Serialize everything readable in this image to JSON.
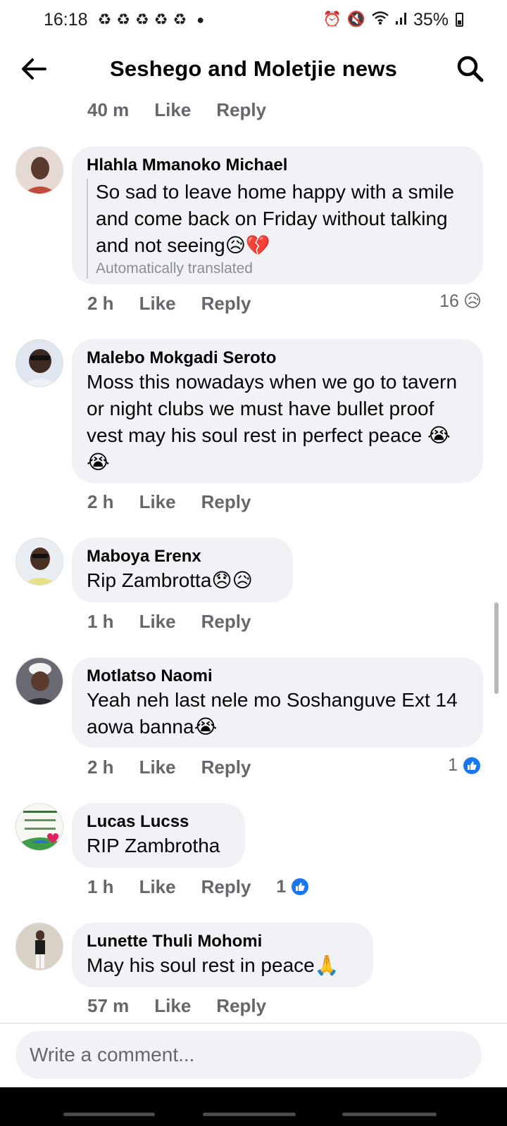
{
  "status_bar": {
    "time": "16:18",
    "battery": "35%",
    "notification_icons": [
      "recycle-icon",
      "recycle-icon",
      "recycle-icon",
      "recycle-icon",
      "recycle-icon"
    ],
    "status_icons": [
      "alarm-icon",
      "mute-icon",
      "wifi-icon",
      "signal-icon",
      "battery-icon"
    ]
  },
  "header": {
    "title": "Seshego and Moletjie news"
  },
  "actions": {
    "like": "Like",
    "reply": "Reply"
  },
  "top_meta": {
    "time": "40 m"
  },
  "comments": [
    {
      "author": "Hlahla Mmanoko Michael",
      "text": "So sad to leave home happy with a smile and come back on Friday without talking and not seeing😥💔",
      "translated_note": "Automatically translated",
      "time": "2 h",
      "reaction_count": "16",
      "reaction_emoji": "😥"
    },
    {
      "author": "Malebo Mokgadi Seroto",
      "text": "Moss this nowadays when we go to tavern or night clubs we must have bullet proof vest may his soul rest in perfect peace 😭😭",
      "time": "2 h"
    },
    {
      "author": "Maboya Erenx",
      "text": "Rip Zambrotta😞😥",
      "time": "1 h"
    },
    {
      "author": "Motlatso Naomi",
      "text": "Yeah neh last nele mo Soshanguve Ext 14 aowa banna😭",
      "time": "2 h",
      "reaction_count": "1"
    },
    {
      "author": "Lucas Lucss",
      "text": "RIP Zambrotha",
      "time": "1 h",
      "reaction_count": "1"
    },
    {
      "author": "Lunette Thuli Mohomi",
      "text": "May his soul rest in peace🙏",
      "time": "57 m"
    }
  ],
  "composer": {
    "placeholder": "Write a comment..."
  },
  "colors": {
    "bubble": "#f0f2f5",
    "secondary_text": "#65676b",
    "like_blue": "#1877f2"
  }
}
